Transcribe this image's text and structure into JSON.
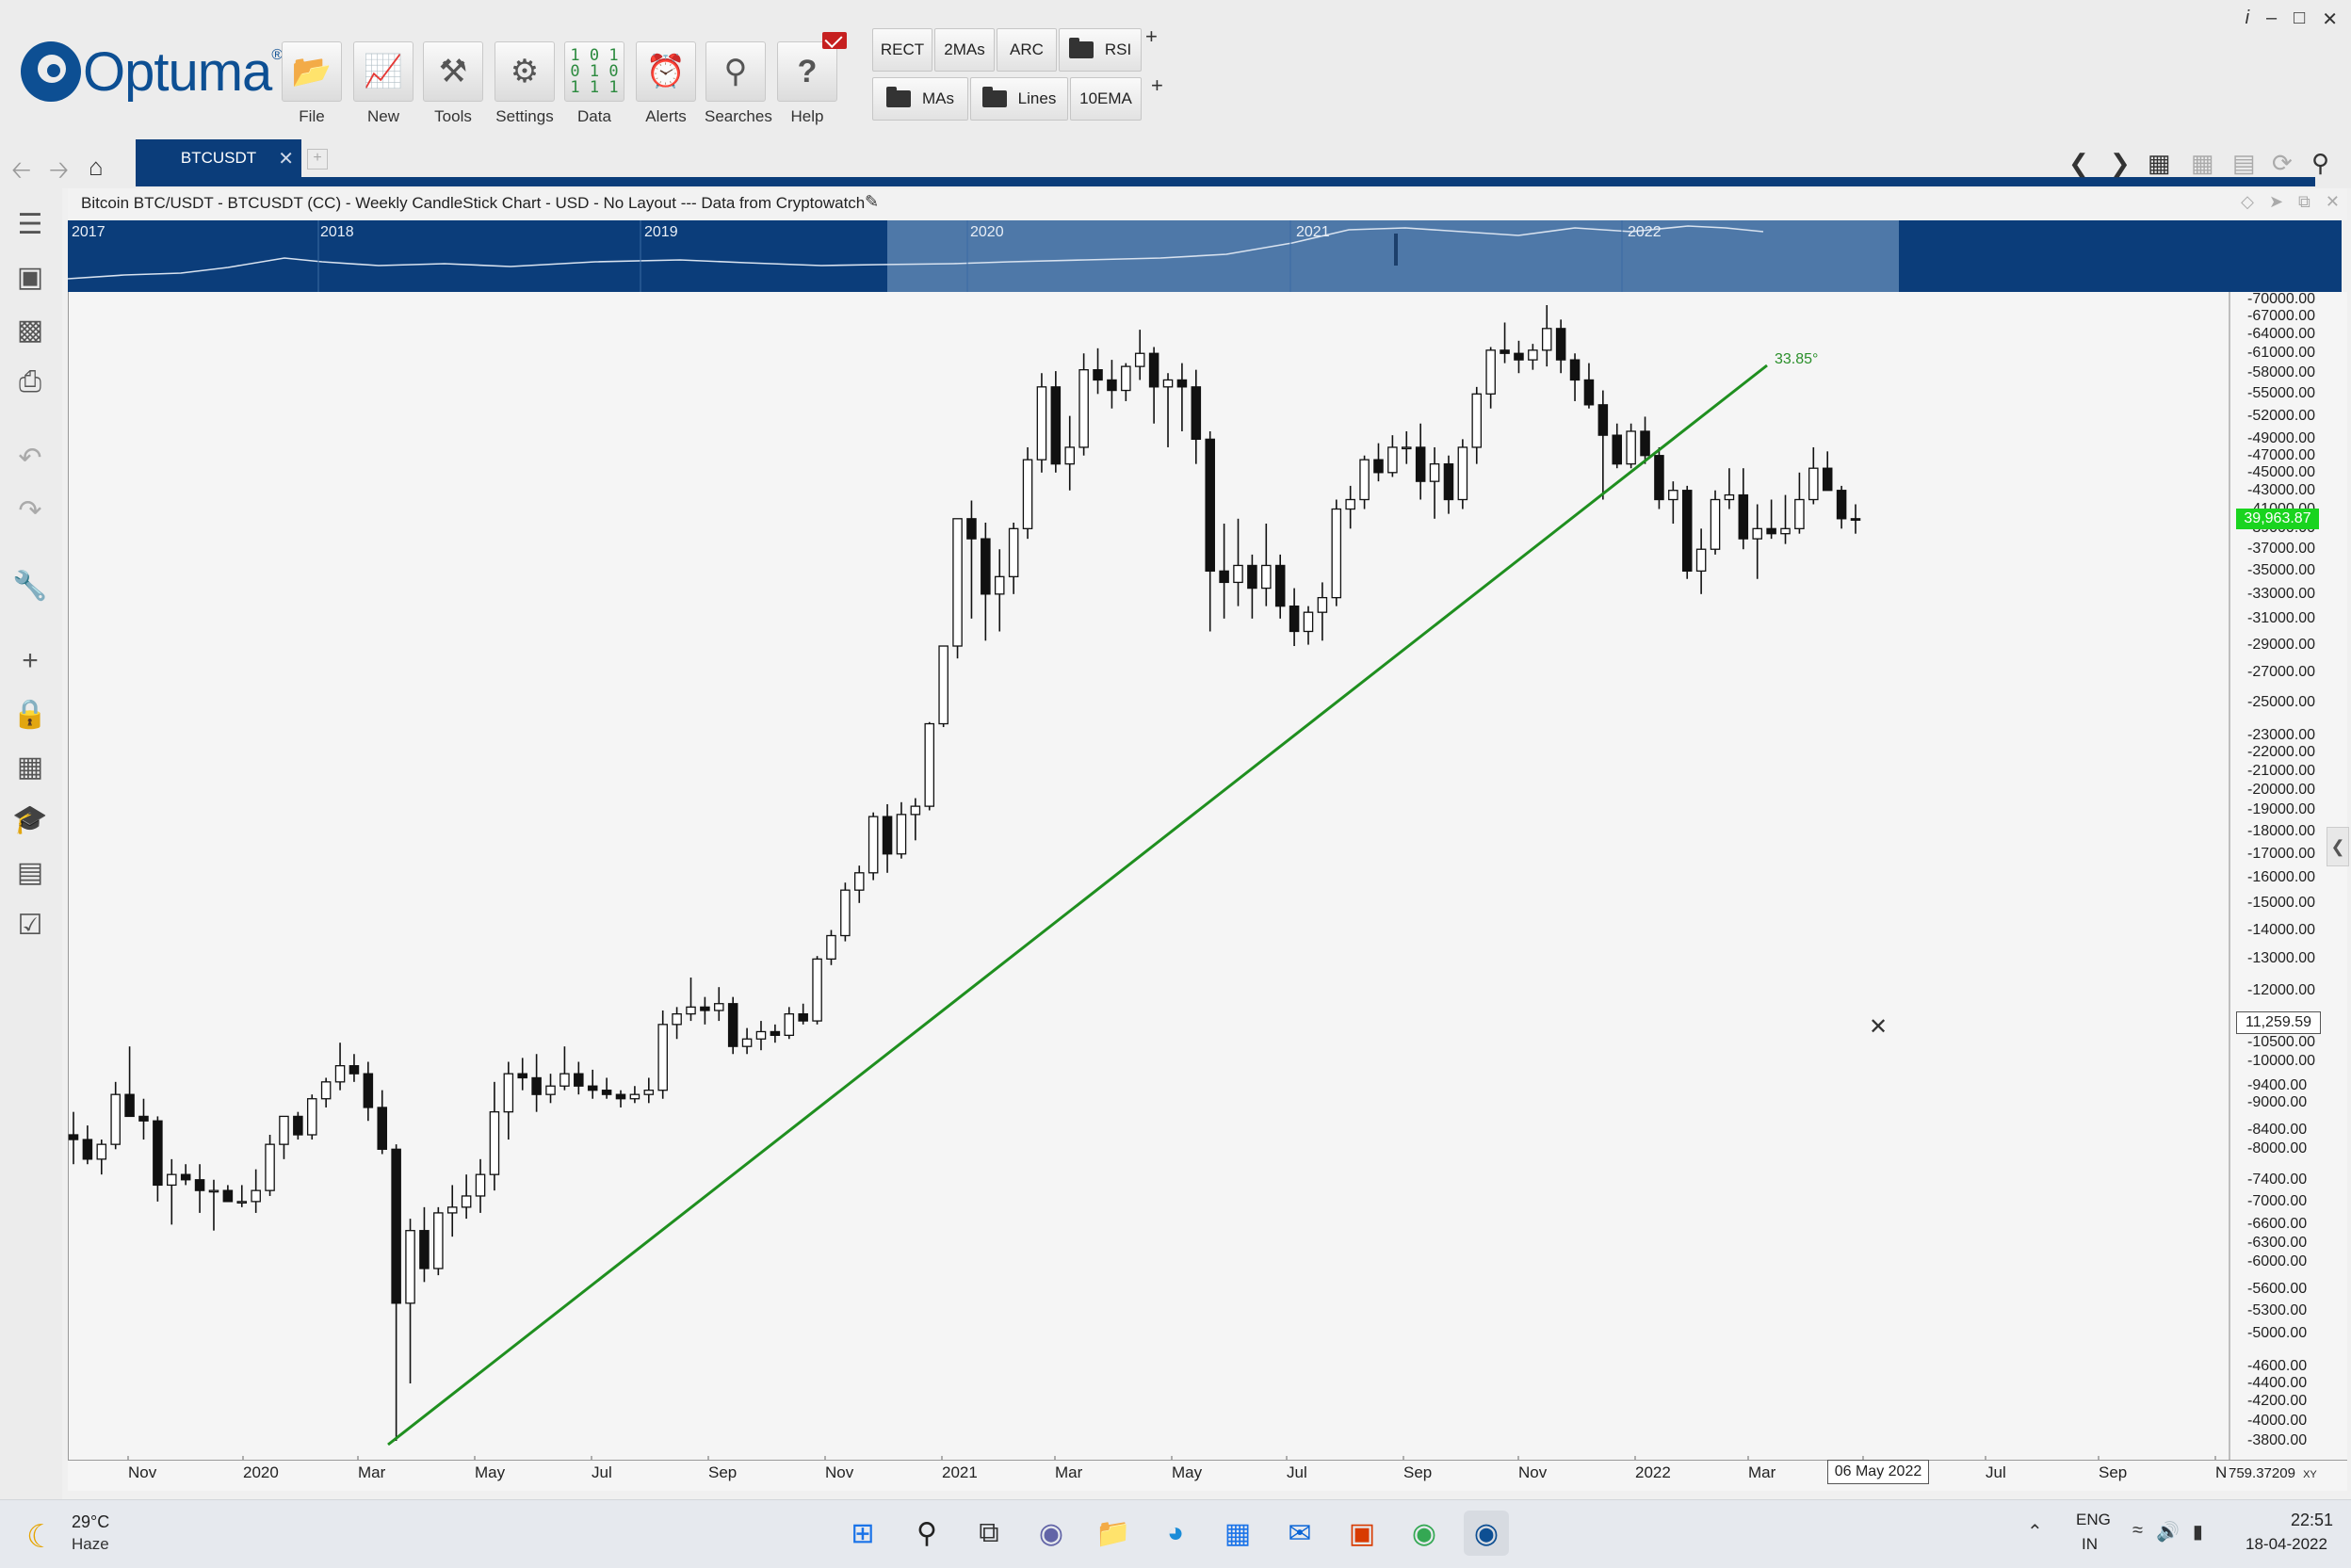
{
  "app": {
    "brand": "Optuma",
    "brand_mark": "®"
  },
  "ribbon": {
    "buttons": [
      {
        "label": "File",
        "icon": "folder-open-icon"
      },
      {
        "label": "New",
        "icon": "new-chart-icon"
      },
      {
        "label": "Tools",
        "icon": "tools-icon"
      },
      {
        "label": "Settings",
        "icon": "gear-icon"
      },
      {
        "label": "Data",
        "icon": "binary-data-icon",
        "glyph": "1 0 1\n0 1 0\n1 1 1"
      },
      {
        "label": "Alerts",
        "icon": "alarm-clock-icon"
      },
      {
        "label": "Searches",
        "icon": "search-icon"
      },
      {
        "label": "Help",
        "icon": "help-icon"
      }
    ],
    "workspace_row1": [
      "RECT",
      "2MAs",
      "ARC",
      "RSI"
    ],
    "workspace_row2": [
      "MAs",
      "Lines",
      "10EMA"
    ],
    "add_symbol": "+"
  },
  "window_controls": {
    "info": "i",
    "min": "–",
    "max": "□",
    "close": "✕"
  },
  "tabs": [
    {
      "label": "BTCUSDT",
      "close": "✕"
    }
  ],
  "chart": {
    "title": "Bitcoin BTC/USDT - BTCUSDT (CC) - Weekly CandleStick Chart - USD - No Layout --- Data from Cryptowatch",
    "overview_years": [
      "2017",
      "2018",
      "2019",
      "2020",
      "2021",
      "2022"
    ],
    "last_price_label": "39,963.87",
    "cursor_price": "11,259.59",
    "cursor_date": "06 May 2022",
    "corner_value": "759.37209",
    "corner_tag": "XY",
    "trendline_angle": "33.85°",
    "trendline_color": "#1f8f1f",
    "price_tag_color": "#19d41f"
  },
  "chart_data": {
    "type": "candlestick",
    "title": "Bitcoin BTC/USDT - BTCUSDT (CC) - Weekly CandleStick Chart - USD - No Layout --- Data from Cryptowatch",
    "y_scale": "log",
    "ylim": [
      3800,
      70000
    ],
    "x_range": [
      "2019-09-30",
      "2022-10-03"
    ],
    "y_ticks": [
      "70000.00",
      "67000.00",
      "64000.00",
      "61000.00",
      "58000.00",
      "55000.00",
      "52000.00",
      "49000.00",
      "47000.00",
      "45000.00",
      "43000.00",
      "41000.00",
      "39000.00",
      "37000.00",
      "35000.00",
      "33000.00",
      "31000.00",
      "29000.00",
      "27000.00",
      "25000.00",
      "23000.00",
      "22000.00",
      "21000.00",
      "20000.00",
      "19000.00",
      "18000.00",
      "17000.00",
      "16000.00",
      "15000.00",
      "14000.00",
      "13000.00",
      "12000.00",
      "11000.00",
      "10500.00",
      "10000.00",
      "9400.00",
      "9000.00",
      "8400.00",
      "8000.00",
      "7400.00",
      "7000.00",
      "6600.00",
      "6300.00",
      "6000.00",
      "5600.00",
      "5300.00",
      "5000.00",
      "4600.00",
      "4400.00",
      "4200.00",
      "4000.00",
      "3800.00"
    ],
    "x_ticks": [
      "Nov",
      "2020",
      "Mar",
      "May",
      "Jul",
      "Sep",
      "Nov",
      "2021",
      "Mar",
      "May",
      "Jul",
      "Sep",
      "Nov",
      "2022",
      "Mar",
      "May",
      "Jul",
      "Sep",
      "N"
    ],
    "candles": [
      [
        8300,
        8800,
        7700,
        8200
      ],
      [
        8200,
        8500,
        7700,
        7800
      ],
      [
        7800,
        8200,
        7500,
        8100
      ],
      [
        8100,
        9500,
        8000,
        9200
      ],
      [
        9200,
        10400,
        8700,
        8700
      ],
      [
        8700,
        9100,
        8200,
        8600
      ],
      [
        8600,
        8700,
        7000,
        7300
      ],
      [
        7300,
        7800,
        6600,
        7500
      ],
      [
        7500,
        7700,
        7300,
        7400
      ],
      [
        7400,
        7700,
        6800,
        7200
      ],
      [
        7200,
        7400,
        6500,
        7200
      ],
      [
        7200,
        7300,
        7000,
        7000
      ],
      [
        7000,
        7300,
        6900,
        7000
      ],
      [
        7000,
        7600,
        6800,
        7200
      ],
      [
        7200,
        8300,
        7100,
        8100
      ],
      [
        8100,
        8700,
        7800,
        8700
      ],
      [
        8700,
        8800,
        8200,
        8300
      ],
      [
        8300,
        9200,
        8200,
        9100
      ],
      [
        9100,
        9600,
        8900,
        9500
      ],
      [
        9500,
        10500,
        9300,
        9900
      ],
      [
        9900,
        10200,
        9500,
        9700
      ],
      [
        9700,
        10000,
        8600,
        8900
      ],
      [
        8900,
        9300,
        7900,
        8000
      ],
      [
        8000,
        8100,
        3800,
        5400
      ],
      [
        5400,
        6700,
        4400,
        6500
      ],
      [
        6500,
        6900,
        5700,
        5900
      ],
      [
        5900,
        6900,
        5800,
        6800
      ],
      [
        6800,
        7300,
        6400,
        6900
      ],
      [
        6900,
        7500,
        6700,
        7100
      ],
      [
        7100,
        7800,
        6800,
        7500
      ],
      [
        7500,
        9500,
        7200,
        8800
      ],
      [
        8800,
        10000,
        8200,
        9700
      ],
      [
        9700,
        10100,
        9300,
        9600
      ],
      [
        9600,
        10200,
        8800,
        9200
      ],
      [
        9200,
        9700,
        9000,
        9400
      ],
      [
        9400,
        10400,
        9300,
        9700
      ],
      [
        9700,
        10000,
        9200,
        9400
      ],
      [
        9400,
        9800,
        9100,
        9300
      ],
      [
        9300,
        9600,
        9100,
        9200
      ],
      [
        9200,
        9300,
        8900,
        9100
      ],
      [
        9100,
        9400,
        9000,
        9200
      ],
      [
        9200,
        9600,
        9000,
        9300
      ],
      [
        9300,
        11400,
        9100,
        11000
      ],
      [
        11000,
        11500,
        10600,
        11300
      ],
      [
        11300,
        12400,
        11100,
        11500
      ],
      [
        11500,
        11800,
        11000,
        11400
      ],
      [
        11400,
        12100,
        11100,
        11600
      ],
      [
        11600,
        11800,
        10200,
        10400
      ],
      [
        10400,
        10900,
        10200,
        10600
      ],
      [
        10600,
        11100,
        10300,
        10800
      ],
      [
        10800,
        11000,
        10500,
        10700
      ],
      [
        10700,
        11500,
        10600,
        11300
      ],
      [
        11300,
        11600,
        11000,
        11100
      ],
      [
        11100,
        13100,
        11000,
        13000
      ],
      [
        13000,
        14000,
        12800,
        13800
      ],
      [
        13800,
        15800,
        13600,
        15500
      ],
      [
        15500,
        16500,
        15000,
        16200
      ],
      [
        16200,
        18900,
        15900,
        18700
      ],
      [
        18700,
        19300,
        16200,
        17000
      ],
      [
        17000,
        19400,
        16800,
        18800
      ],
      [
        18800,
        19600,
        17600,
        19200
      ],
      [
        19200,
        23800,
        19000,
        23700
      ],
      [
        23700,
        28400,
        23500,
        28900
      ],
      [
        28900,
        35000,
        28000,
        40000
      ],
      [
        40000,
        41900,
        31000,
        38000
      ],
      [
        38000,
        39600,
        29300,
        33000
      ],
      [
        33000,
        37000,
        30000,
        34500
      ],
      [
        34500,
        39600,
        33000,
        39000
      ],
      [
        39000,
        48000,
        38000,
        46500
      ],
      [
        46500,
        58000,
        45000,
        56000
      ],
      [
        56000,
        58300,
        45000,
        46000
      ],
      [
        46000,
        52000,
        43000,
        48000
      ],
      [
        48000,
        61000,
        47000,
        58500
      ],
      [
        58500,
        61800,
        55000,
        57000
      ],
      [
        57000,
        60000,
        53000,
        55500
      ],
      [
        55500,
        59500,
        54000,
        59000
      ],
      [
        59000,
        64800,
        57000,
        61000
      ],
      [
        61000,
        62000,
        51000,
        56000
      ],
      [
        56000,
        58000,
        48000,
        57000
      ],
      [
        57000,
        59500,
        50000,
        56000
      ],
      [
        56000,
        58500,
        46000,
        49000
      ],
      [
        49000,
        50000,
        30000,
        35000
      ],
      [
        35000,
        39500,
        31000,
        34000
      ],
      [
        34000,
        40000,
        32000,
        35500
      ],
      [
        35500,
        36500,
        31000,
        33500
      ],
      [
        33500,
        39500,
        32000,
        35500
      ],
      [
        35500,
        36500,
        31000,
        32000
      ],
      [
        32000,
        33500,
        28900,
        30000
      ],
      [
        30000,
        32000,
        29000,
        31500
      ],
      [
        31500,
        34000,
        29300,
        32700
      ],
      [
        32700,
        42000,
        32000,
        41000
      ],
      [
        41000,
        43500,
        39000,
        42000
      ],
      [
        42000,
        47000,
        41000,
        46500
      ],
      [
        46500,
        48500,
        44000,
        45000
      ],
      [
        45000,
        49500,
        44500,
        48000
      ],
      [
        48000,
        50000,
        46000,
        48000
      ],
      [
        48000,
        51000,
        42000,
        44000
      ],
      [
        44000,
        48000,
        40000,
        46000
      ],
      [
        46000,
        47000,
        40500,
        42000
      ],
      [
        42000,
        49000,
        41000,
        48000
      ],
      [
        48000,
        56000,
        46000,
        55000
      ],
      [
        55000,
        62000,
        53000,
        61500
      ],
      [
        61500,
        66000,
        59500,
        61000
      ],
      [
        61000,
        63000,
        58000,
        60000
      ],
      [
        60000,
        62500,
        58500,
        61500
      ],
      [
        61500,
        69000,
        59000,
        65000
      ],
      [
        65000,
        66500,
        58000,
        60000
      ],
      [
        60000,
        61000,
        54000,
        57000
      ],
      [
        57000,
        59500,
        53000,
        53500
      ],
      [
        53500,
        55500,
        42000,
        49500
      ],
      [
        49500,
        51000,
        45500,
        46000
      ],
      [
        46000,
        51000,
        45500,
        50000
      ],
      [
        50000,
        51900,
        46000,
        47000
      ],
      [
        47000,
        48000,
        41000,
        42000
      ],
      [
        42000,
        44000,
        39500,
        43000
      ],
      [
        43000,
        43500,
        34300,
        35000
      ],
      [
        35000,
        39000,
        33000,
        37000
      ],
      [
        37000,
        43000,
        36500,
        42000
      ],
      [
        42000,
        45500,
        41000,
        42500
      ],
      [
        42500,
        45500,
        37000,
        38000
      ],
      [
        38000,
        41500,
        34300,
        39000
      ],
      [
        39000,
        42000,
        38000,
        38500
      ],
      [
        38500,
        42500,
        37500,
        39000
      ],
      [
        39000,
        45000,
        38500,
        42000
      ],
      [
        42000,
        48000,
        41500,
        45500
      ],
      [
        45500,
        47500,
        43000,
        43000
      ],
      [
        43000,
        43500,
        39000,
        40000
      ],
      [
        40000,
        41500,
        38500,
        39963
      ]
    ]
  },
  "taskbar": {
    "temperature": "29°C",
    "weather": "Haze",
    "weather_icon": "moon-icon",
    "apps": [
      "windows-start-icon",
      "search-icon",
      "task-view-icon",
      "teams-chat-icon",
      "file-explorer-icon",
      "edge-browser-icon",
      "store-icon",
      "mail-icon",
      "office-icon",
      "chrome-icon",
      "optuma-icon"
    ],
    "lang_line1": "ENG",
    "lang_line2": "IN",
    "time": "22:51",
    "date": "18-04-2022"
  }
}
